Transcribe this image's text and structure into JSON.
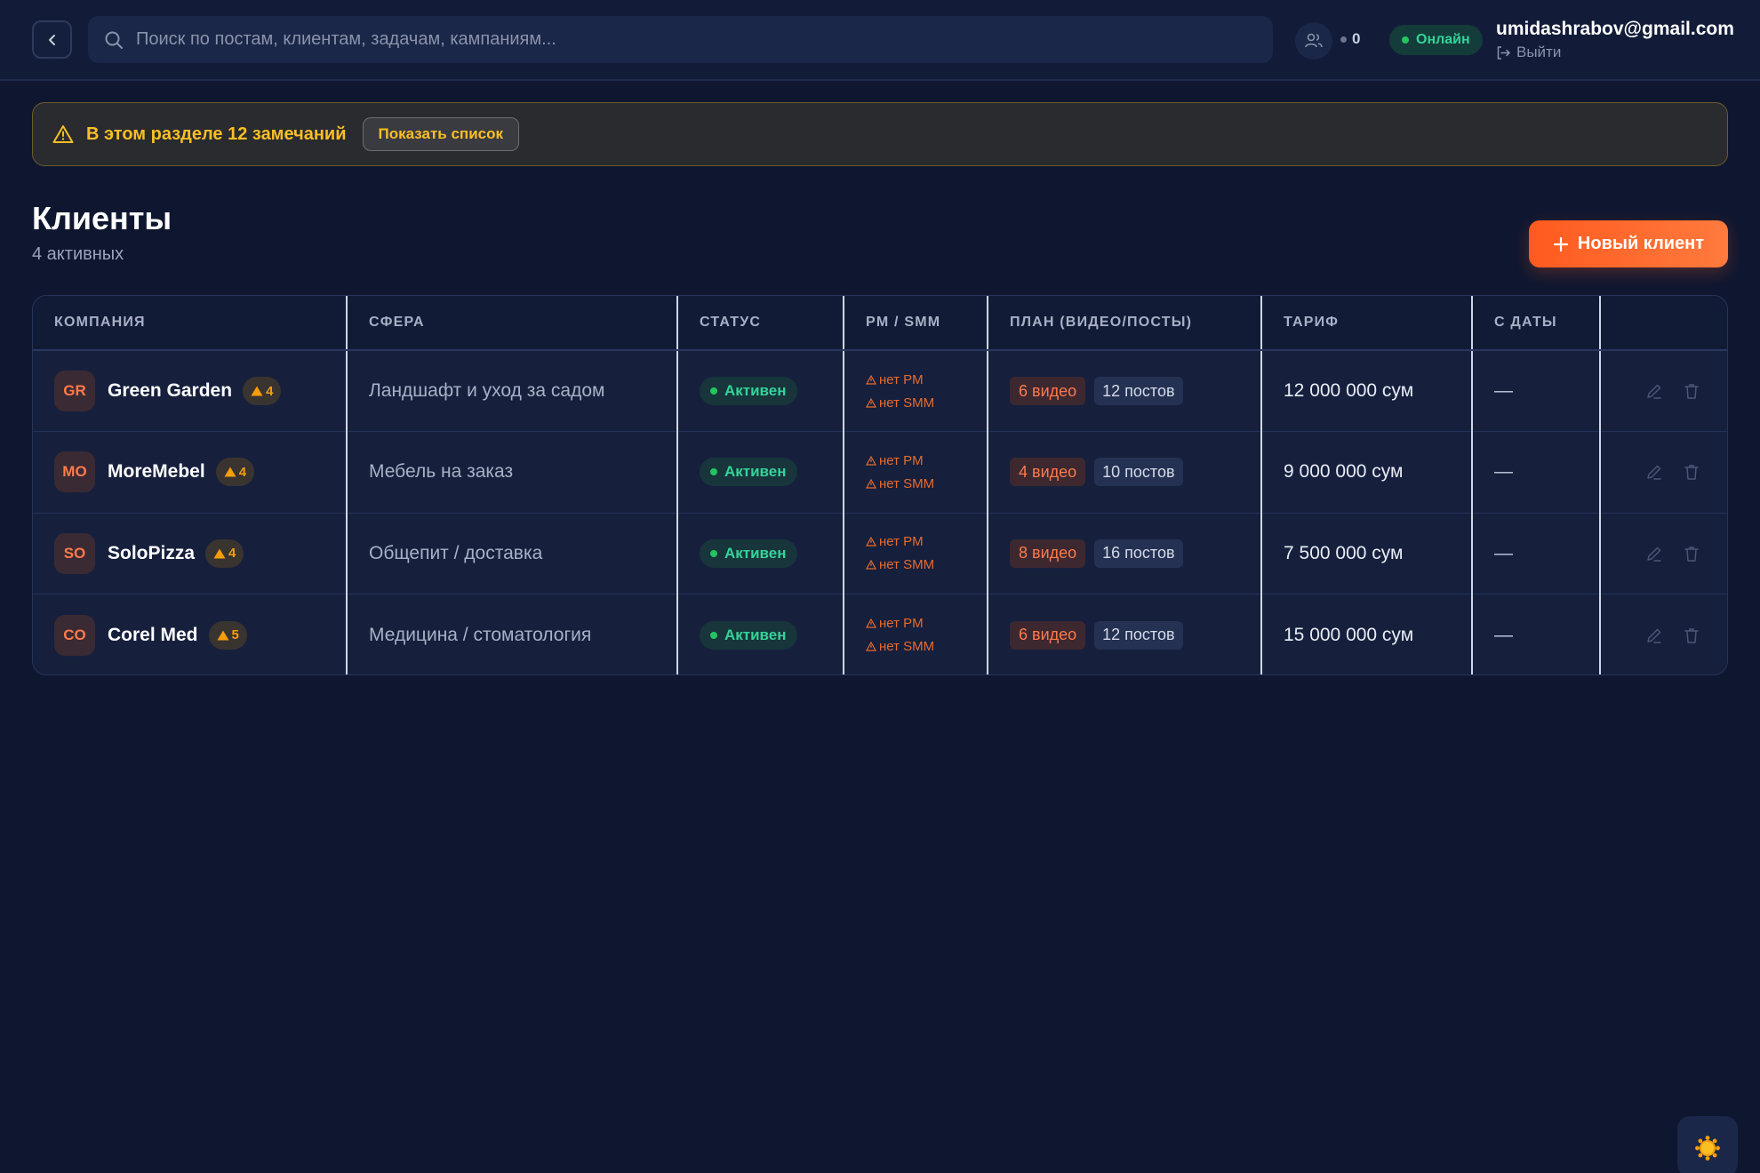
{
  "header": {
    "search_placeholder": "Поиск по постам, клиентам, задачам, кампаниям...",
    "users_count": "0",
    "online_label": "Онлайн",
    "user_email": "umidashrabov@gmail.com",
    "logout_label": "Выйти"
  },
  "alert": {
    "text": "В этом разделе 12 замечаний",
    "button_label": "Показать список"
  },
  "page": {
    "title": "Клиенты",
    "subtitle": "4 активных",
    "new_button_label": "Новый клиент"
  },
  "table": {
    "columns": [
      "КОМПАНИЯ",
      "СФЕРА",
      "СТАТУС",
      "PM / SMM",
      "ПЛАН (ВИДЕО/ПОСТЫ)",
      "ТАРИФ",
      "С ДАТЫ",
      ""
    ],
    "rows": [
      {
        "initials": "GR",
        "name": "Green Garden",
        "warnings": "4",
        "sphere": "Ландшафт и уход за садом",
        "status": "Активен",
        "pm": "нет PM",
        "smm": "нет SMM",
        "videos": "6 видео",
        "posts": "12 постов",
        "tariff": "12 000 000 сум",
        "since": "—"
      },
      {
        "initials": "MO",
        "name": "MoreMebel",
        "warnings": "4",
        "sphere": "Мебель на заказ",
        "status": "Активен",
        "pm": "нет PM",
        "smm": "нет SMM",
        "videos": "4 видео",
        "posts": "10 постов",
        "tariff": "9 000 000 сум",
        "since": "—"
      },
      {
        "initials": "SO",
        "name": "SoloPizza",
        "warnings": "4",
        "sphere": "Общепит / доставка",
        "status": "Активен",
        "pm": "нет PM",
        "smm": "нет SMM",
        "videos": "8 видео",
        "posts": "16 постов",
        "tariff": "7 500 000 сум",
        "since": "—"
      },
      {
        "initials": "CO",
        "name": "Corel Med",
        "warnings": "5",
        "sphere": "Медицина / стоматология",
        "status": "Активен",
        "pm": "нет PM",
        "smm": "нет SMM",
        "videos": "6 видео",
        "posts": "12 постов",
        "tariff": "15 000 000 сум",
        "since": "—"
      }
    ]
  },
  "icons": {
    "back": "chevron-left-icon",
    "search": "search-icon",
    "users": "users-icon",
    "logout": "logout-icon",
    "alert": "warning-triangle-icon",
    "plus": "plus-icon",
    "edit": "pencil-icon",
    "delete": "trash-icon",
    "theme": "sun-icon"
  },
  "colors": {
    "accent": "#ff5a1f",
    "background": "#0f1730",
    "online": "#22c55e",
    "warning": "#fbbf24"
  }
}
